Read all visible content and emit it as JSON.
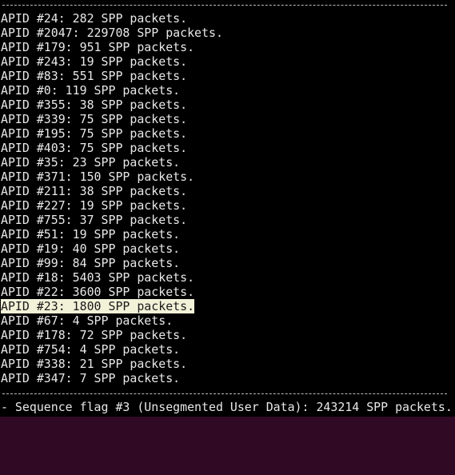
{
  "terminal": {
    "packet_lines": [
      "APID #24: 282 SPP packets.",
      "APID #2047: 229708 SPP packets.",
      "APID #179: 951 SPP packets.",
      "APID #243: 19 SPP packets.",
      "APID #83: 551 SPP packets.",
      "APID #0: 119 SPP packets.",
      "APID #355: 38 SPP packets.",
      "APID #339: 75 SPP packets.",
      "APID #195: 75 SPP packets.",
      "APID #403: 75 SPP packets.",
      "APID #35: 23 SPP packets.",
      "APID #371: 150 SPP packets.",
      "APID #211: 38 SPP packets.",
      "APID #227: 19 SPP packets.",
      "APID #755: 37 SPP packets.",
      "APID #51: 19 SPP packets.",
      "APID #19: 40 SPP packets.",
      "APID #99: 84 SPP packets.",
      "APID #18: 5403 SPP packets.",
      "APID #22: 3600 SPP packets.",
      "APID #23: 1800 SPP packets.",
      "APID #67: 4 SPP packets.",
      "APID #178: 72 SPP packets.",
      "APID #754: 4 SPP packets.",
      "APID #338: 21 SPP packets.",
      "APID #347: 7 SPP packets."
    ],
    "highlighted_index": 20,
    "sequence_flag_line": "- Sequence flag #3 (Unsegmented User Data): 243214 SPP packets."
  },
  "colors": {
    "background": "#000000",
    "text": "#e8e8e8",
    "selection_background": "#f2f2d9",
    "selection_text": "#1a1a1a"
  }
}
